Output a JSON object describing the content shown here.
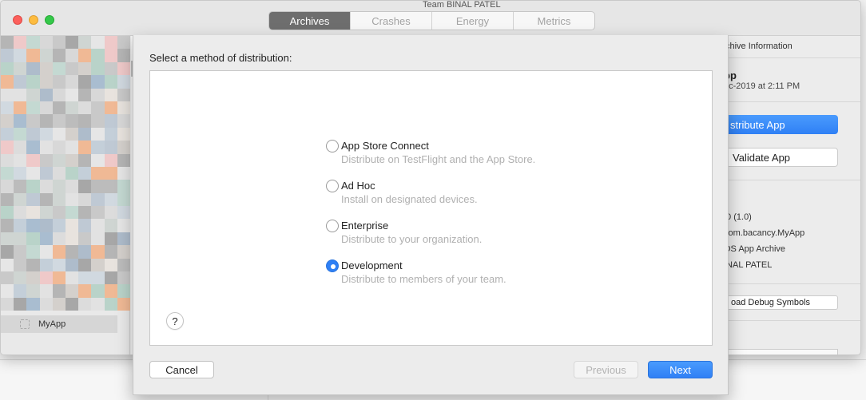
{
  "window": {
    "tabs": [
      {
        "label": "Archives",
        "active": true
      },
      {
        "label": "Crashes",
        "active": false
      },
      {
        "label": "Energy",
        "active": false
      },
      {
        "label": "Metrics",
        "active": false
      }
    ],
    "team_label": "Team BINAL PATEL"
  },
  "sidebar": {
    "selected_app": "MyApp"
  },
  "info_panel": {
    "header": "chive Information",
    "app_name": "pp",
    "date": "ec-2019 at 2:11 PM",
    "distribute_label": "stribute App",
    "validate_label": "Validate App",
    "version": ".0 (1.0)",
    "identifier": "com.bacancy.MyApp",
    "type": "OS App Archive",
    "team": "INAL PATEL",
    "download_symbols_label": "oad Debug Symbols"
  },
  "dialog": {
    "title": "Select a method of distribution:",
    "options": [
      {
        "title": "App Store Connect",
        "description": "Distribute on TestFlight and the App Store.",
        "selected": false
      },
      {
        "title": "Ad Hoc",
        "description": "Install on designated devices.",
        "selected": false
      },
      {
        "title": "Enterprise",
        "description": "Distribute to your organization.",
        "selected": false
      },
      {
        "title": "Development",
        "description": "Distribute to members of your team.",
        "selected": true
      }
    ],
    "help_label": "?",
    "cancel_label": "Cancel",
    "previous_label": "Previous",
    "next_label": "Next"
  },
  "colors": {
    "accent": "#2f80f5",
    "active_tab": "#6e6e6e"
  }
}
